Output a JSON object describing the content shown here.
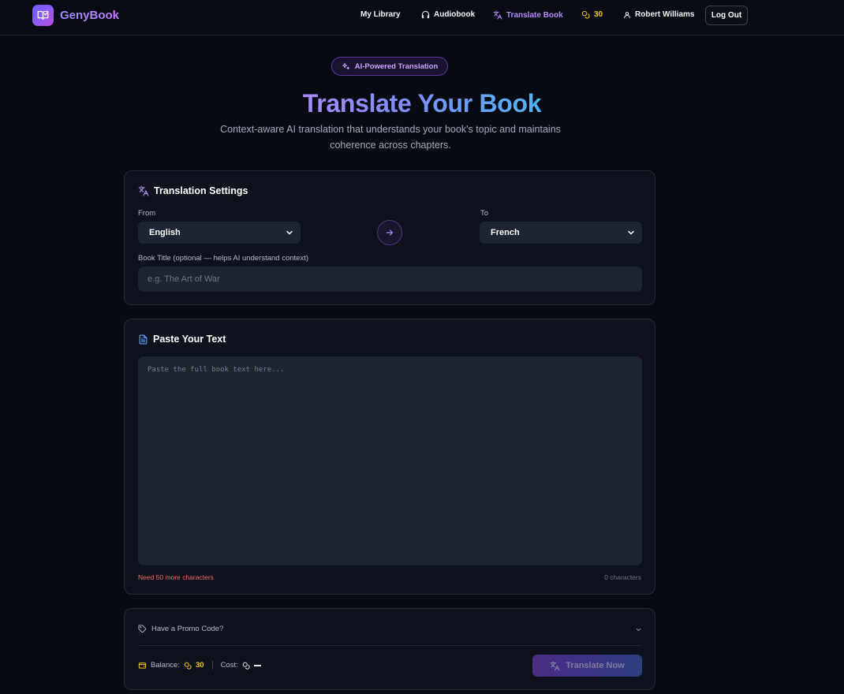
{
  "brand": {
    "name": "GenyBook",
    "icon": "book-icon"
  },
  "nav": {
    "library": "My Library",
    "audiobook": "Audiobook",
    "translate": "Translate Book",
    "coins": "30",
    "user": "Robert Williams",
    "logout": "Log Out"
  },
  "hero": {
    "badge": "AI-Powered Translation",
    "title": "Translate Your Book",
    "subtitle": "Context-aware AI translation that understands your book's topic and maintains coherence across chapters."
  },
  "settings": {
    "title": "Translation Settings",
    "from_label": "From",
    "from_value": "English",
    "to_label": "To",
    "to_value": "French",
    "book_title_label": "Book Title (optional — helps AI understand context)",
    "book_title_placeholder": "e.g. The Art of War"
  },
  "text_section": {
    "title": "Paste Your Text",
    "placeholder": "Paste the full book text here...",
    "warning": "Need 50 more characters",
    "count": "0 characters"
  },
  "footer_card": {
    "promo": "Have a Promo Code?",
    "balance_label": "Balance:",
    "balance_value": "30",
    "cost_label": "Cost:",
    "button": "Translate Now"
  },
  "colors": {
    "accent": "#8b5cf6",
    "coin": "#f5c518",
    "warning": "#f26d6d",
    "background": "#070a12"
  }
}
